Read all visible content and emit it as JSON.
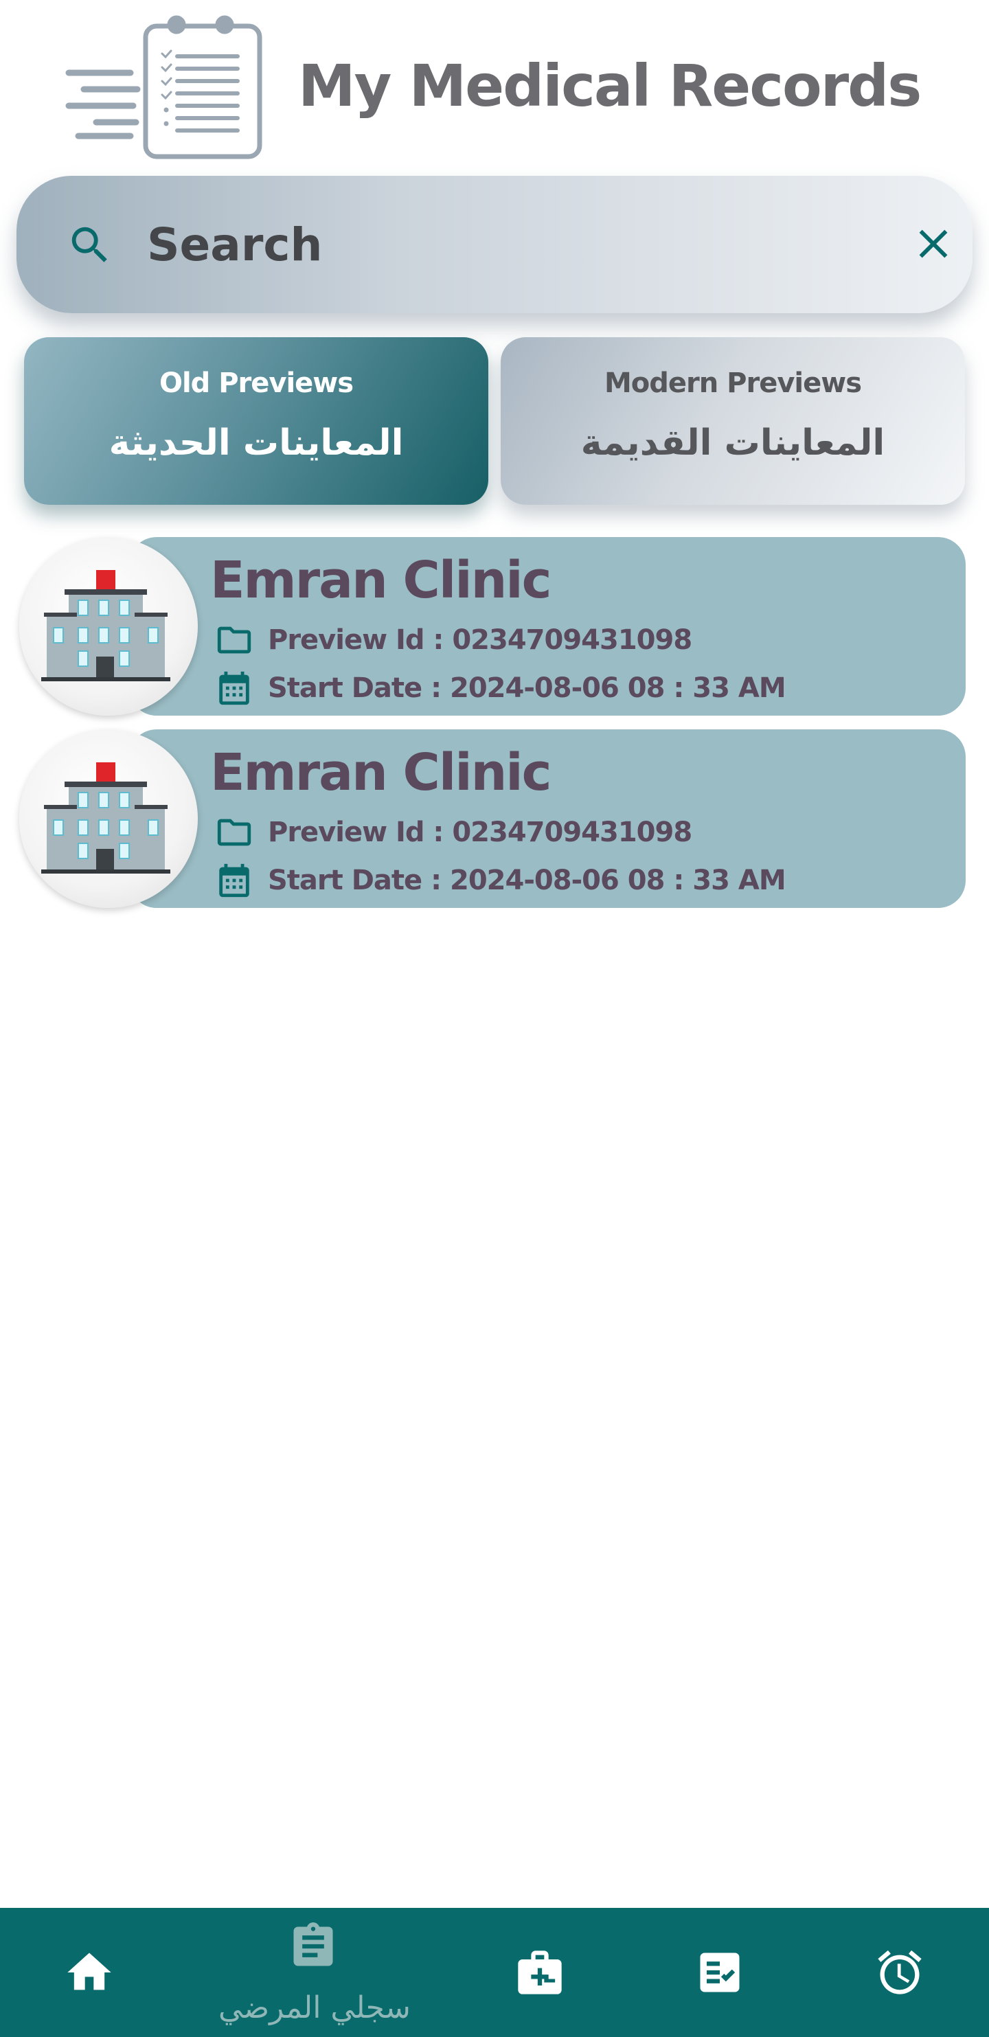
{
  "header": {
    "title": "My Medical Records",
    "logo_icon": "clipboard-checklist-icon"
  },
  "search": {
    "placeholder": "Search",
    "value": "",
    "search_icon": "search-icon",
    "clear_icon": "close-icon"
  },
  "tabs": [
    {
      "label_en": "Old Previews",
      "label_ar": "المعاينات الحديثة",
      "active": true
    },
    {
      "label_en": "Modern Previews",
      "label_ar": "المعاينات القديمة",
      "active": false
    }
  ],
  "records": [
    {
      "clinic": "Emran Clinic",
      "preview_id": "Preview Id : 0234709431098",
      "start_date": "Start Date : 2024-08-06  08 : 33 AM"
    },
    {
      "clinic": "Emran Clinic",
      "preview_id": "Preview Id : 0234709431098",
      "start_date": "Start Date : 2024-08-06  08 : 33 AM"
    }
  ],
  "bottom_nav": {
    "items": [
      {
        "icon": "home-icon",
        "label": ""
      },
      {
        "icon": "clipboard-icon",
        "label": "سجلي المرضي"
      },
      {
        "icon": "medical-kit-icon",
        "label": ""
      },
      {
        "icon": "task-list-icon",
        "label": ""
      },
      {
        "icon": "alarm-clock-icon",
        "label": ""
      }
    ]
  },
  "colors": {
    "primary": "#086a6b",
    "card": "#9abcc4",
    "clinic_text": "#5b4a5e",
    "active_tab": "#175f66",
    "nav_label": "#8fb7b7"
  }
}
